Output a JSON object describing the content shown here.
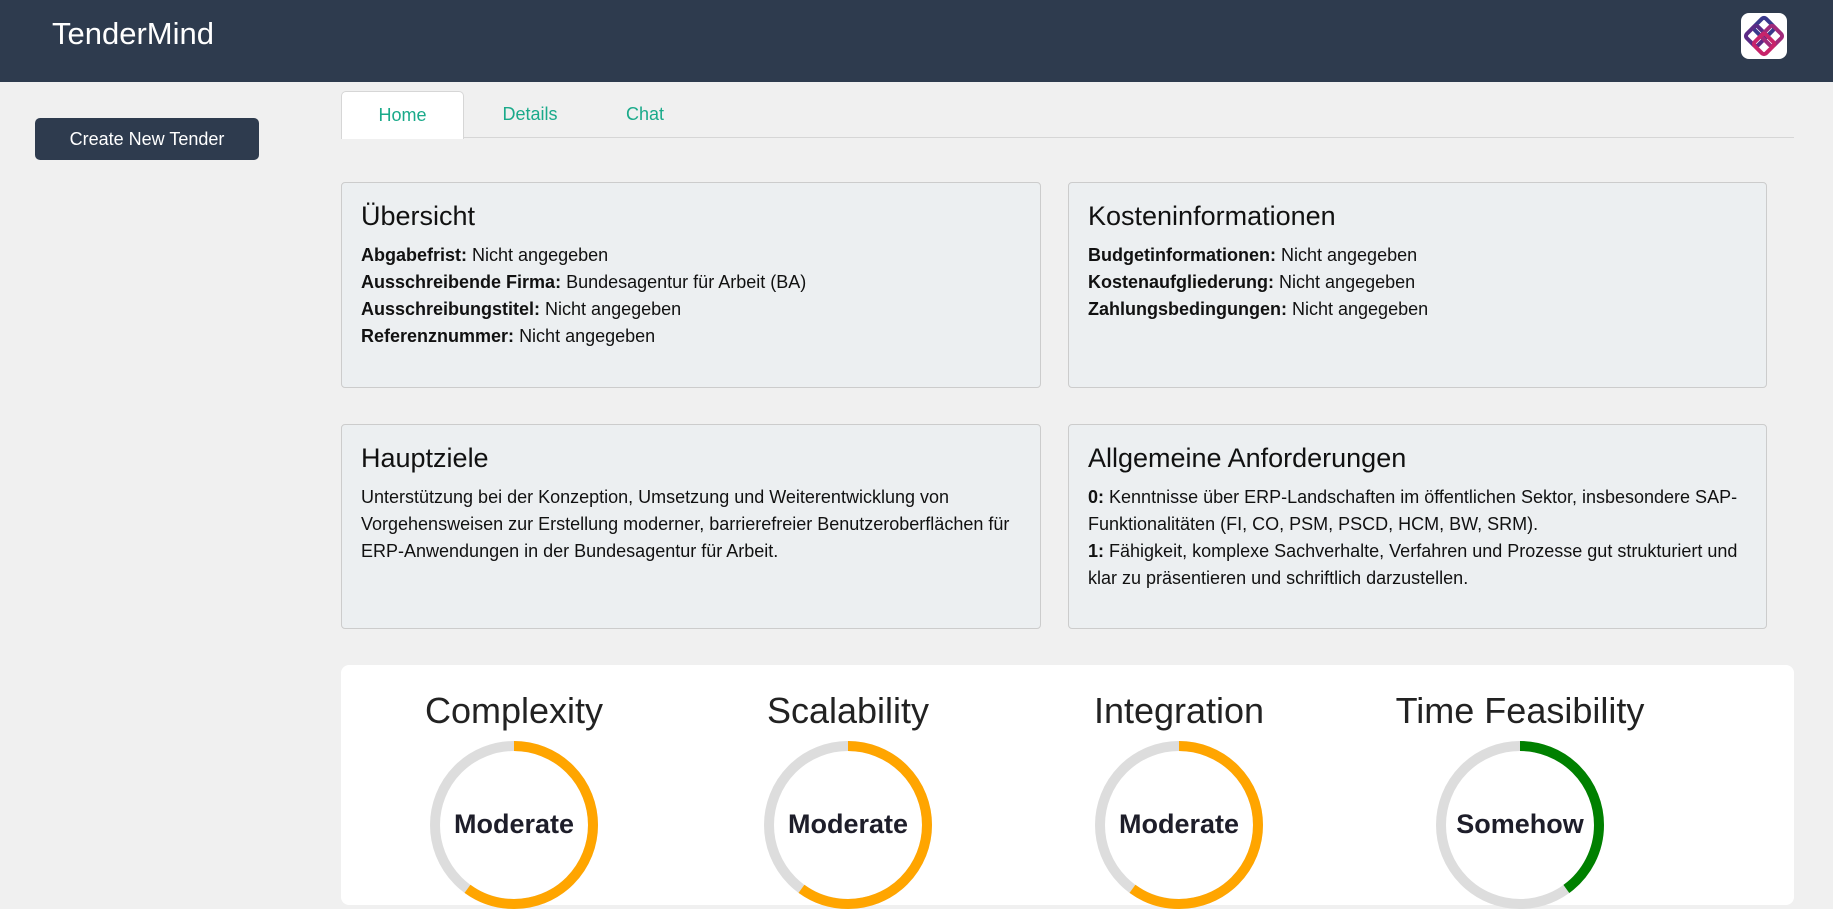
{
  "app": {
    "title": "TenderMind",
    "logo_icon": "app-logo-icon"
  },
  "sidebar": {
    "create_button": "Create New Tender"
  },
  "tabs": [
    {
      "label": "Home",
      "active": true
    },
    {
      "label": "Details",
      "active": false
    },
    {
      "label": "Chat",
      "active": false
    }
  ],
  "overview": {
    "title": "Übersicht",
    "rows": [
      {
        "label": "Abgabefrist:",
        "value": "Nicht angegeben"
      },
      {
        "label": "Ausschreibende Firma:",
        "value": "Bundesagentur für Arbeit (BA)"
      },
      {
        "label": "Ausschreibungstitel:",
        "value": "Nicht angegeben"
      },
      {
        "label": "Referenznummer:",
        "value": "Nicht angegeben"
      }
    ]
  },
  "costs": {
    "title": "Kosteninformationen",
    "rows": [
      {
        "label": "Budgetinformationen:",
        "value": "Nicht angegeben"
      },
      {
        "label": "Kostenaufgliederung:",
        "value": "Nicht angegeben"
      },
      {
        "label": "Zahlungsbedingungen:",
        "value": "Nicht angegeben"
      }
    ]
  },
  "goals": {
    "title": "Hauptziele",
    "text": "Unterstützung bei der Konzeption, Umsetzung und Weiterentwicklung von Vorgehensweisen zur Erstellung moderner, barrierefreier Benutzeroberflächen für ERP-Anwendungen in der Bundesagentur für Arbeit."
  },
  "requirements": {
    "title": "Allgemeine Anforderungen",
    "items": [
      {
        "index": "0:",
        "text": "Kenntnisse über ERP-Landschaften im öffentlichen Sektor, insbesondere SAP-Funktionalitäten (FI, CO, PSM, PSCD, HCM, BW, SRM)."
      },
      {
        "index": "1:",
        "text": "Fähigkeit, komplexe Sachverhalte, Verfahren und Prozesse gut strukturiert und klar zu präsentieren und schriftlich darzustellen."
      }
    ]
  },
  "metrics": [
    {
      "title": "Complexity",
      "label": "Moderate",
      "fill": 0.6,
      "color": "#ffa500"
    },
    {
      "title": "Scalability",
      "label": "Moderate",
      "fill": 0.6,
      "color": "#ffa500"
    },
    {
      "title": "Integration",
      "label": "Moderate",
      "fill": 0.6,
      "color": "#ffa500"
    },
    {
      "title": "Time Feasibility",
      "label": "Somehow",
      "fill": 0.4,
      "color": "#008000"
    }
  ],
  "colors": {
    "header_bg": "#2e3b4e",
    "tab_text": "#1aaa8a",
    "gauge_track": "#dddddd"
  }
}
